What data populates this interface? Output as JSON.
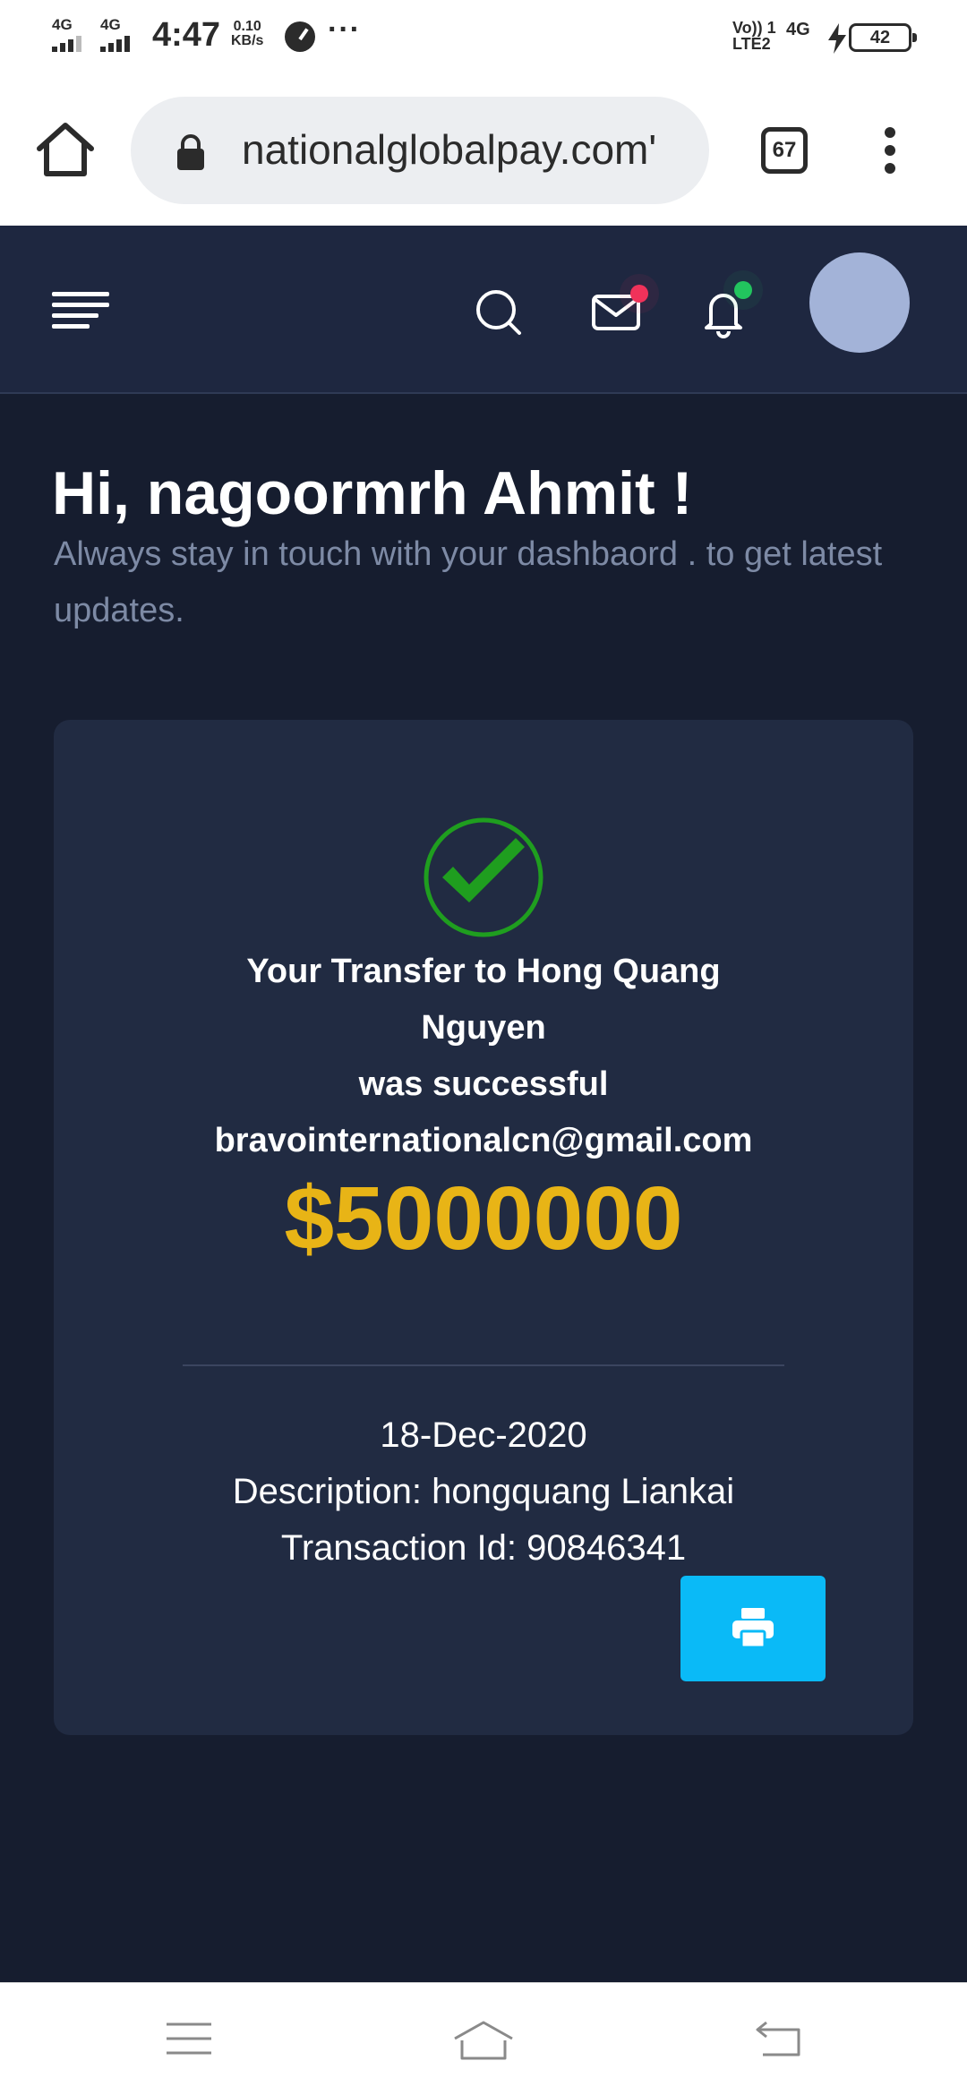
{
  "status_bar": {
    "signal1_label": "4G",
    "signal2_label": "4G",
    "time": "4:47",
    "speed_value": "0.10",
    "speed_unit": "KB/s",
    "more": "···",
    "volte_line1": "Vo)) 1",
    "volte_line2": "LTE2",
    "network2": "4G",
    "battery_level": "42"
  },
  "browser": {
    "url": "bravointernationalglobalpay.com",
    "url_visible": "'nationalglobalpay.com",
    "tab_count": "67"
  },
  "app": {
    "greeting": "Hi, nagoormrh Ahmit !",
    "subtitle": "Always stay in touch with your dashbaord . to get latest updates.",
    "notification_colors": {
      "mail_dot": "#f0325a",
      "bell_dot": "#22c55e"
    },
    "card": {
      "line1": "Your Transfer to Hong Quang",
      "line2": "Nguyen",
      "line3": "was successful",
      "email": "bravointernationalcn@gmail.com",
      "amount": "$5000000",
      "date": "18-Dec-2020",
      "description": "Description: hongquang Liankai",
      "transaction_id": "Transaction Id: 90846341",
      "amount_color": "#e8b416",
      "button_color": "#0abaf7"
    }
  }
}
